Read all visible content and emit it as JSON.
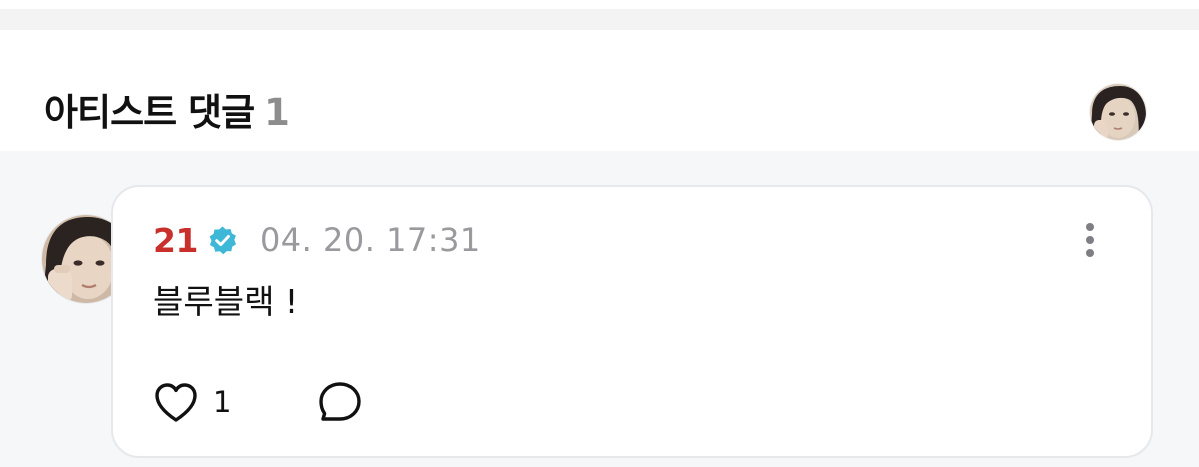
{
  "section": {
    "title": "아티스트 댓글",
    "count": "1"
  },
  "comment": {
    "author": "21",
    "timestamp": "04. 20. 17:31",
    "body": "블루블랙 !",
    "like_count": "1"
  },
  "icons": {
    "verified": "verified-badge-icon",
    "more": "more-vertical-icon",
    "like": "heart-outline-icon",
    "reply": "speech-bubble-icon"
  },
  "colors": {
    "author_name": "#c9302c",
    "verified_badge": "#3fb7d6",
    "timestamp": "#9a9a9e",
    "count": "#8d8d8d"
  }
}
